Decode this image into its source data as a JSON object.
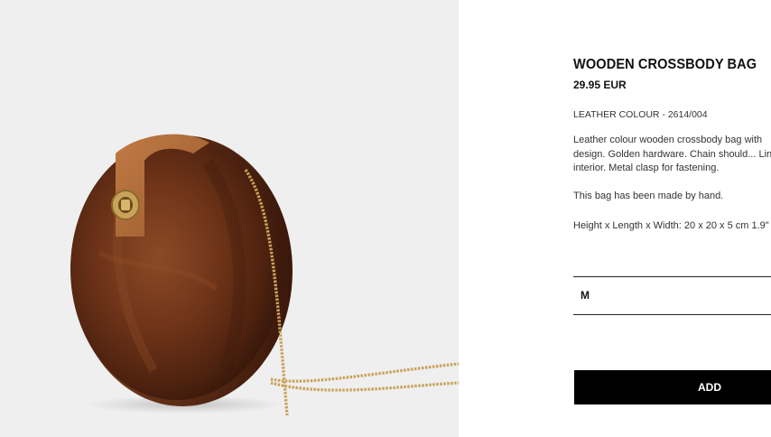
{
  "product": {
    "name": "WOODEN CROSSBODY BAG",
    "price": "29.95 EUR",
    "colour_ref": "LEATHER COLOUR - 2614/004",
    "description": "Leather colour wooden crossbody bag with design. Golden hardware. Chain should... Lined interior. Metal clasp for fastening.",
    "handmade_note": "This bag has been made by hand.",
    "dimensions": "Height x Length x Width: 20 x 20 x 5 cm 1.9\""
  },
  "size_selector": {
    "selected": "M"
  },
  "actions": {
    "add_label": "ADD"
  },
  "colors": {
    "image_background": "#efefef",
    "wood": "#6b3219",
    "strap": "#b46f3c",
    "chain": "#c9a35a",
    "button": "#000000"
  }
}
